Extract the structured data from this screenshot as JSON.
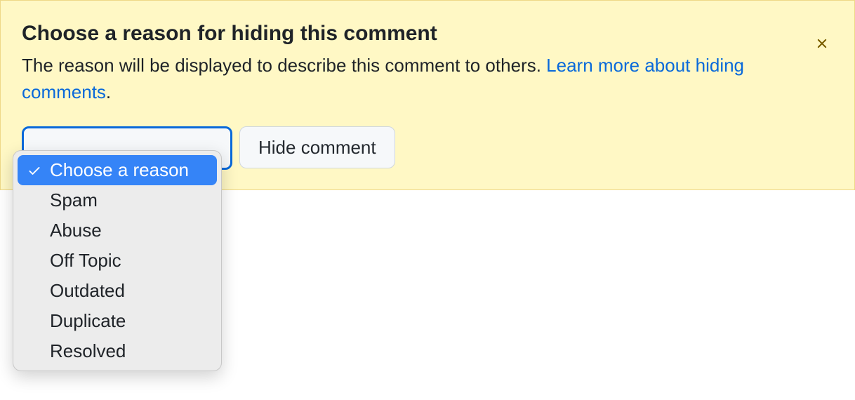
{
  "alert": {
    "title": "Choose a reason for hiding this comment",
    "description_before_link": "The reason will be displayed to describe this comment to others. ",
    "link_text": "Learn more about hiding comments",
    "description_after_link": "."
  },
  "controls": {
    "hide_button_label": "Hide comment"
  },
  "dropdown": {
    "selected_index": 0,
    "options": [
      "Choose a reason",
      "Spam",
      "Abuse",
      "Off Topic",
      "Outdated",
      "Duplicate",
      "Resolved"
    ]
  }
}
